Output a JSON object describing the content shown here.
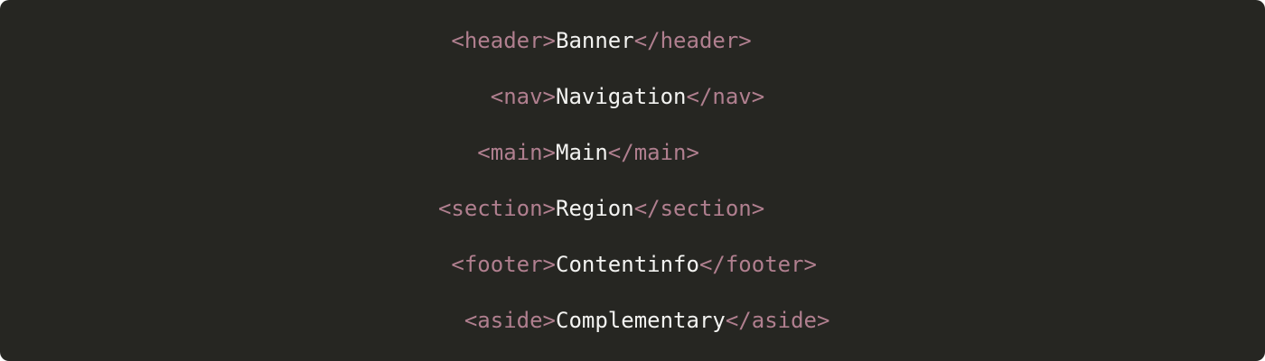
{
  "colors": {
    "background": "#262622",
    "tag": "#b07f8f",
    "text": "#f3f3f1"
  },
  "lines": [
    {
      "open_tag": "<header>",
      "text": "Banner",
      "close_tag": "</header>"
    },
    {
      "open_tag": "<nav>",
      "text": "Navigation",
      "close_tag": "</nav>"
    },
    {
      "open_tag": "<main>",
      "text": "Main",
      "close_tag": "</main>"
    },
    {
      "open_tag": "<section>",
      "text": "Region",
      "close_tag": "</section>"
    },
    {
      "open_tag": "<footer>",
      "text": "Contentinfo",
      "close_tag": "</footer>"
    },
    {
      "open_tag": "<aside>",
      "text": "Complementary",
      "close_tag": "</aside>"
    }
  ]
}
